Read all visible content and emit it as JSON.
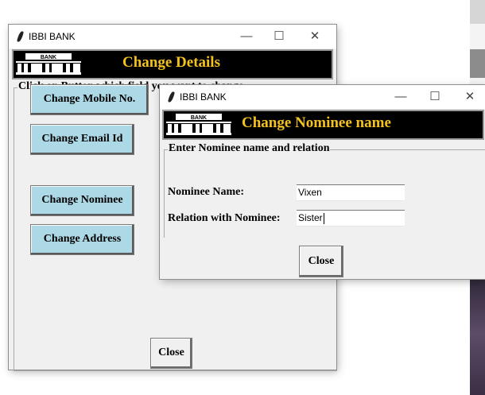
{
  "main_window": {
    "title": "IBBI BANK",
    "controls": {
      "minimize": "—",
      "maximize": "☐",
      "close": "✕"
    },
    "logo_text": "BANK",
    "header": "Change Details",
    "group_label": "Click on Button which field you want to change",
    "buttons": {
      "mobile": "Change Mobile No.",
      "email": "Change Email Id",
      "nominee": "Change Nominee",
      "address": "Change Address"
    },
    "close_label": "Close"
  },
  "dialog": {
    "title": "IBBI BANK",
    "controls": {
      "minimize": "—",
      "maximize": "☐",
      "close": "✕"
    },
    "logo_text": "BANK",
    "header": "Change Nominee name",
    "group_label": "Enter Nominee name and relation",
    "nominee_name_label": "Nominee Name:",
    "nominee_name_value": "Vixen",
    "relation_label": "Relation with Nominee:",
    "relation_value": "Sister",
    "close_label": "Close"
  },
  "colors": {
    "header_text": "#f4c21e",
    "header_bg": "#000000",
    "button_blue": "#add8e6",
    "window_bg": "#f0f0f0"
  }
}
